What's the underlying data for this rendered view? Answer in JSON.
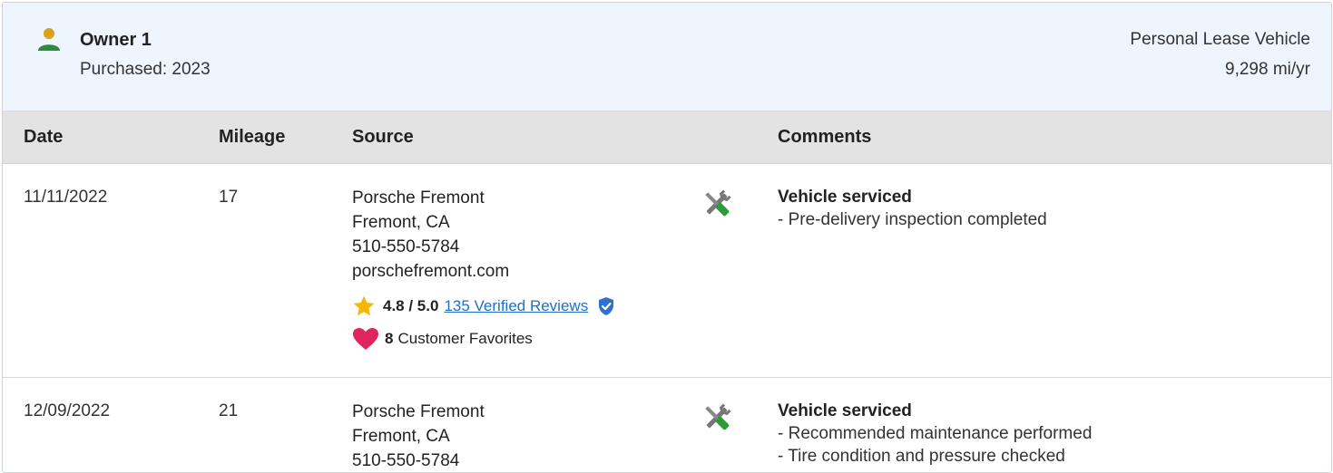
{
  "owner": {
    "title": "Owner 1",
    "purchased": "Purchased: 2023",
    "usage_type": "Personal Lease Vehicle",
    "miles_per_year": "9,298 mi/yr"
  },
  "columns": {
    "date": "Date",
    "mileage": "Mileage",
    "source": "Source",
    "comments": "Comments"
  },
  "records": [
    {
      "date": "11/11/2022",
      "mileage": "17",
      "source": {
        "name": "Porsche Fremont",
        "location": "Fremont, CA",
        "phone": "510-550-5784",
        "website": "porschefremont.com",
        "rating": "4.8 / 5.0",
        "reviews_link": "135 Verified Reviews",
        "favorites_count": "8",
        "favorites_label": "Customer Favorites"
      },
      "comment_title": "Vehicle serviced",
      "comment_lines": [
        "- Pre-delivery inspection completed"
      ]
    },
    {
      "date": "12/09/2022",
      "mileage": "21",
      "source": {
        "name": "Porsche Fremont",
        "location": "Fremont, CA",
        "phone": "510-550-5784"
      },
      "comment_title": "Vehicle serviced",
      "comment_lines": [
        "- Recommended maintenance performed",
        "- Tire condition and pressure checked"
      ]
    }
  ],
  "colors": {
    "header_bg": "#eef5fc",
    "table_header_bg": "#e3e3e3",
    "link": "#1f6fc5",
    "star": "#f5b80a",
    "heart": "#e0245e",
    "owner_icon_green": "#2e8b3e",
    "owner_icon_gold": "#d8a21c"
  },
  "icons": {
    "owner": "person-icon",
    "service": "wrench-screwdriver-icon",
    "rating": "star-icon",
    "verified": "shield-check-icon",
    "favorites": "heart-icon"
  }
}
